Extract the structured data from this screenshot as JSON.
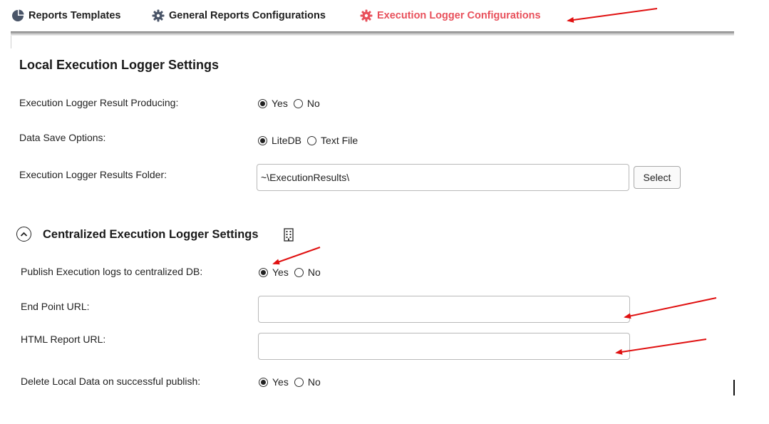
{
  "tabs": [
    {
      "label": "Reports Templates",
      "icon": "pie-chart-icon"
    },
    {
      "label": "General Reports Configurations",
      "icon": "gear-icon"
    },
    {
      "label": "Execution Logger Configurations",
      "icon": "gear-icon",
      "active": true
    }
  ],
  "local": {
    "title": "Local Execution Logger Settings",
    "result_producing": {
      "label": "Execution Logger Result Producing:",
      "options": [
        "Yes",
        "No"
      ],
      "selected": "Yes"
    },
    "save_options": {
      "label": "Data Save Options:",
      "options": [
        "LiteDB",
        "Text File"
      ],
      "selected": "LiteDB"
    },
    "results_folder": {
      "label": "Execution Logger Results Folder:",
      "value": "~\\ExecutionResults\\",
      "button": "Select"
    }
  },
  "central": {
    "title": "Centralized Execution Logger Settings",
    "publish": {
      "label": "Publish Execution logs to centralized DB:",
      "options": [
        "Yes",
        "No"
      ],
      "selected": "Yes"
    },
    "endpoint": {
      "label": "End Point URL:",
      "value": ""
    },
    "html_report": {
      "label": "HTML Report URL:",
      "value": ""
    },
    "delete_local": {
      "label": "Delete Local Data on successful publish:",
      "options": [
        "Yes",
        "No"
      ],
      "selected": "Yes"
    }
  },
  "colors": {
    "accent": "#e8505b",
    "annotation_arrow": "#e01010"
  }
}
